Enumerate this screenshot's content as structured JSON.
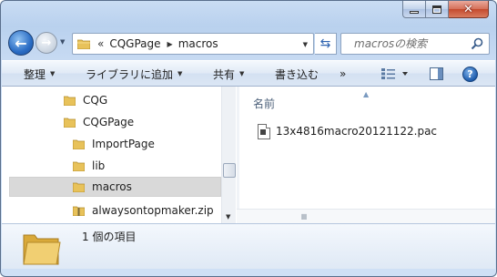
{
  "window": {
    "caption_buttons": [
      "minimize",
      "maximize",
      "close"
    ]
  },
  "navigation": {
    "back_icon": "back-arrow-icon",
    "forward_icon": "forward-arrow-icon"
  },
  "address_bar": {
    "overflow_marker": "«",
    "crumbs": [
      "CQGPage",
      "macros"
    ]
  },
  "search": {
    "placeholder": "macrosの検索"
  },
  "command_bar": {
    "items": [
      {
        "label": "整理",
        "dropdown": true
      },
      {
        "label": "ライブラリに追加",
        "dropdown": true
      },
      {
        "label": "共有",
        "dropdown": true
      },
      {
        "label": "書き込む",
        "dropdown": false
      },
      {
        "label": "»",
        "dropdown": false
      }
    ]
  },
  "nav_pane": {
    "items": [
      {
        "label": "CQG",
        "level": 1,
        "selected": false,
        "icon": "folder-icon"
      },
      {
        "label": "CQGPage",
        "level": 1,
        "selected": false,
        "icon": "folder-icon"
      },
      {
        "label": "ImportPage",
        "level": 2,
        "selected": false,
        "icon": "folder-icon"
      },
      {
        "label": "lib",
        "level": 2,
        "selected": false,
        "icon": "folder-icon"
      },
      {
        "label": "macros",
        "level": 2,
        "selected": true,
        "icon": "folder-icon"
      },
      {
        "label": "alwaysontopmaker.zip",
        "level": 2,
        "selected": false,
        "icon": "zip-folder-icon"
      }
    ]
  },
  "file_list": {
    "column_header": "名前",
    "files": [
      {
        "name": "13x4816macro20121122.pac",
        "icon": "pac-file-icon"
      }
    ]
  },
  "details_pane": {
    "status": "1 個の項目"
  },
  "colors": {
    "chrome": "#c9dcf3",
    "close_button": "#c44a2e",
    "selection": "#d9d9d9",
    "folder": "#e8c25a"
  }
}
